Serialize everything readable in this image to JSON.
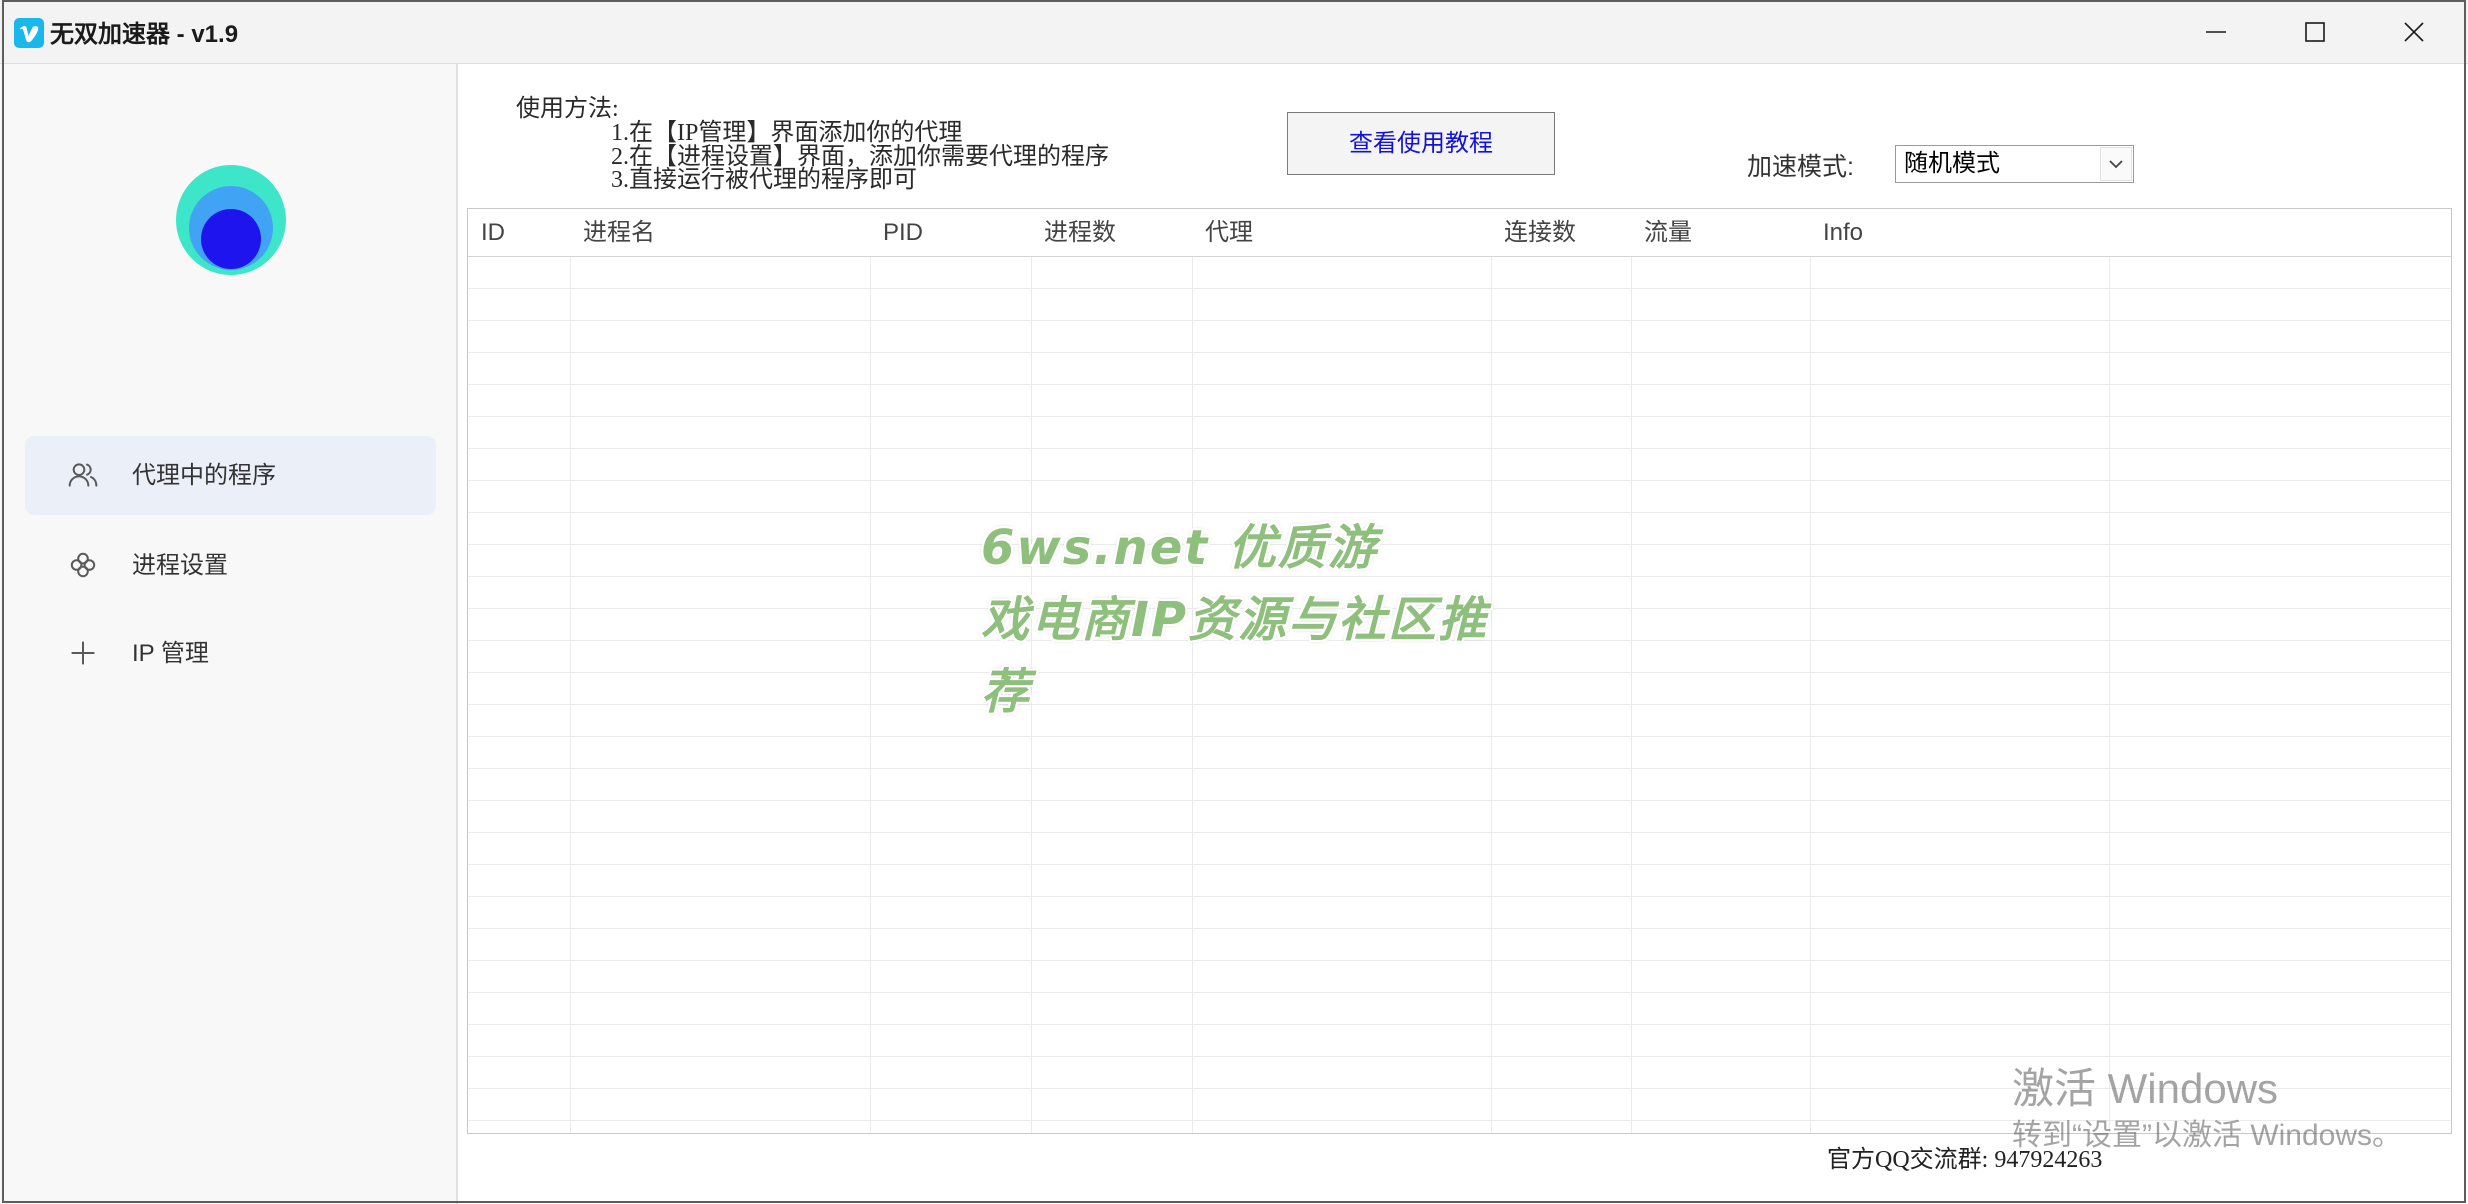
{
  "window": {
    "title": "无双加速器 - v1.9",
    "app_icon": "v-logo-icon",
    "controls": [
      "minimize-icon",
      "maximize-icon",
      "close-icon"
    ]
  },
  "sidebar": {
    "logo": "concentric-circles-logo",
    "items": [
      {
        "label": "代理中的程序",
        "icon": "users-icon",
        "active": true
      },
      {
        "label": "进程设置",
        "icon": "process-icon",
        "active": false
      },
      {
        "label": "IP 管理",
        "icon": "plus-icon",
        "active": false
      }
    ]
  },
  "instructions": {
    "heading": "使用方法:",
    "steps": [
      "1.在【IP管理】界面添加你的代理",
      "2.在【进程设置】界面，添加你需要代理的程序",
      "3.直接运行被代理的程序即可"
    ]
  },
  "tutorial_button": {
    "label": "查看使用教程"
  },
  "mode": {
    "label": "加速模式:",
    "selected": "随机模式",
    "icon": "chevron-down-icon"
  },
  "table": {
    "columns": [
      "ID",
      "进程名",
      "PID",
      "进程数",
      "代理",
      "连接数",
      "流量",
      "Info"
    ],
    "rows": []
  },
  "footer": {
    "qq_group": "官方QQ交流群: 947924263"
  },
  "watermark": {
    "lines": [
      "6ws.net 优质游",
      "戏电商IP资源与社区推",
      "荐"
    ]
  },
  "activation_notice": {
    "title": "激活 Windows",
    "subtitle": "转到“设置”以激活 Windows。"
  },
  "colors": {
    "accent_blue": "#1212dc",
    "active_nav_bg": "#ebeff8",
    "logo_outer": "#3de6c8",
    "logo_middle": "#41a3f3",
    "logo_inner": "#1d14ee",
    "watermark_green": "#8fbf7c",
    "app_icon_bg": "#1ab7ea"
  }
}
